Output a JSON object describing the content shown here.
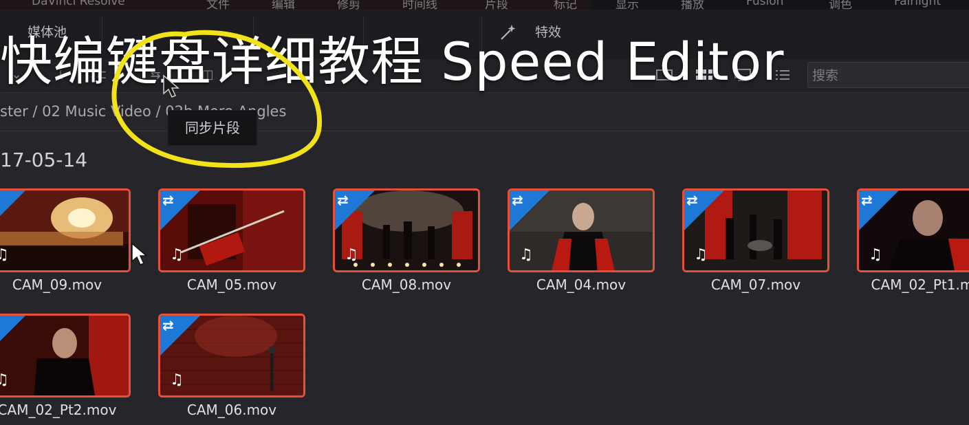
{
  "menubar": {
    "items": [
      "DaVinci Resolve",
      "文件",
      "编辑",
      "修剪",
      "时间线",
      "片段",
      "标记",
      "显示",
      "播放",
      "Fusion",
      "调色",
      "Fairlight"
    ]
  },
  "toolbar": {
    "media_pool": "媒体池",
    "effects": "特效",
    "search_placeholder": "搜索"
  },
  "tooltip": "同步片段",
  "overlay_title": "快编键盘详细教程 Speed Editor",
  "breadcrumb": "ster / 02 Music Video / 02b More Angles",
  "date_group": "17-05-14",
  "clips": [
    {
      "name": "CAM_09.mov"
    },
    {
      "name": "CAM_05.mov"
    },
    {
      "name": "CAM_08.mov"
    },
    {
      "name": "CAM_04.mov"
    },
    {
      "name": "CAM_07.mov"
    },
    {
      "name": "CAM_02_Pt1.mov"
    },
    {
      "name": "CAM_02_Pt2.mov"
    },
    {
      "name": "CAM_06.mov"
    }
  ],
  "icons": {
    "sync": "sync-arrows-icon",
    "audio": "music-note-icon"
  },
  "colors": {
    "clip_border": "#e4503a",
    "sync_badge": "#1e78d6",
    "highlight_circle": "#f2e21a"
  }
}
